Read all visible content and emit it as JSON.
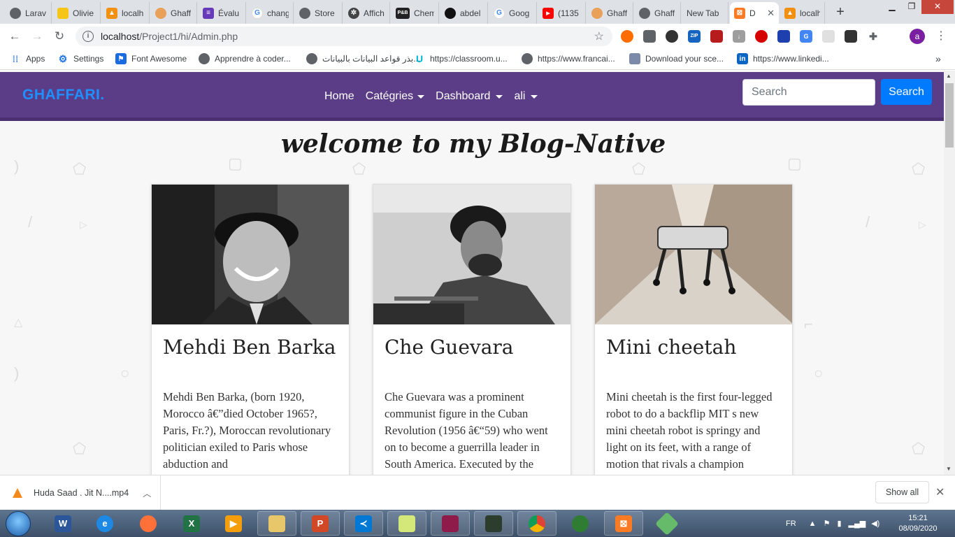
{
  "browser": {
    "tabs": [
      {
        "title": "Larav",
        "icon": "chrome-page-icon",
        "color": "#5f6368"
      },
      {
        "title": "Olivie",
        "icon": "notebook-icon",
        "color": "#f5c518"
      },
      {
        "title": "localh",
        "icon": "phpmyadmin-icon",
        "color": "#f29111"
      },
      {
        "title": "Ghaff",
        "icon": "avatar-icon",
        "color": "#e9a15a"
      },
      {
        "title": "Évalu",
        "icon": "forms-icon",
        "color": "#673ab7"
      },
      {
        "title": "chang",
        "icon": "google-icon",
        "color": "#4285f4"
      },
      {
        "title": "Store",
        "icon": "chrome-page-icon",
        "color": "#5f6368"
      },
      {
        "title": "Affich",
        "icon": "gear-icon",
        "color": "#444444"
      },
      {
        "title": "Chem",
        "icon": "pb-icon",
        "color": "#222222"
      },
      {
        "title": "abdel",
        "icon": "github-icon",
        "color": "#111111"
      },
      {
        "title": "Goog",
        "icon": "google-icon",
        "color": "#4285f4"
      },
      {
        "title": "(1135",
        "icon": "youtube-icon",
        "color": "#ff0000"
      },
      {
        "title": "Ghaff",
        "icon": "avatar-icon",
        "color": "#e9a15a"
      },
      {
        "title": "Ghaff",
        "icon": "chrome-page-icon",
        "color": "#5f6368"
      },
      {
        "title": "New Tab",
        "icon": "",
        "color": ""
      },
      {
        "title": "D",
        "icon": "xampp-icon",
        "color": "#fb7a24"
      },
      {
        "title": "localh",
        "icon": "phpmyadmin-icon",
        "color": "#f29111"
      }
    ],
    "url_host": "localhost",
    "url_path": "/Project1/hi/Admin.php",
    "bookmarks": [
      {
        "label": "Apps",
        "icon": "apps-grid-icon",
        "color": "#4285f4"
      },
      {
        "label": "Settings",
        "icon": "gear-icon",
        "color": "#1a73e8"
      },
      {
        "label": "Font Awesome",
        "icon": "flag-icon",
        "color": "#1a6ae0"
      },
      {
        "label": "Apprendre à coder...",
        "icon": "globe-icon",
        "color": "#5f6368"
      },
      {
        "label": "بذر قواعد البيانات بالبيانات...",
        "icon": "globe-icon",
        "color": "#5f6368"
      },
      {
        "label": "https://classroom.u...",
        "icon": "udemy-icon",
        "color": "#00b4d8"
      },
      {
        "label": "https://www.francai...",
        "icon": "globe-icon",
        "color": "#5f6368"
      },
      {
        "label": "Download your sce...",
        "icon": "video-icon",
        "color": "#7a8aa8"
      },
      {
        "label": "https://www.linkedi...",
        "icon": "linkedin-icon",
        "color": "#0a66c2"
      }
    ],
    "more_bookmarks": "»",
    "profile_initial": "a"
  },
  "site": {
    "brand": "GHAFFARI.",
    "nav": [
      {
        "label": "Home",
        "dropdown": false
      },
      {
        "label": "Catégries",
        "dropdown": true
      },
      {
        "label": "Dashboard",
        "dropdown": true
      },
      {
        "label": "ali",
        "dropdown": true
      }
    ],
    "search_placeholder": "Search",
    "search_button": "Search",
    "headline": "welcome to my Blog-Native",
    "cards": [
      {
        "title": "Mehdi Ben Barka",
        "text": "Mehdi Ben Barka, (born 1920, Morocco â€”died October 1965?, Paris, Fr.?), Moroccan revolutionary politician exiled to Paris whose abduction and",
        "image": "portrait-photo"
      },
      {
        "title": "Che Guevara",
        "text": "Che Guevara was a prominent communist figure in the Cuban Revolution (1956 â€“59) who went on to become a guerrilla leader in South America. Executed by the",
        "image": "portrait-photo"
      },
      {
        "title": "Mini cheetah",
        "text": "Mini cheetah is the first four-legged robot to do a backflip MIT s new mini cheetah robot is springy and light on its feet, with a range of motion that rivals a champion",
        "image": "robot-photo"
      }
    ]
  },
  "download": {
    "filename": "Huda Saad . Jit N....mp4",
    "show_all": "Show all"
  },
  "taskbar": {
    "lang": "FR",
    "time": "15:21",
    "date": "08/09/2020"
  }
}
